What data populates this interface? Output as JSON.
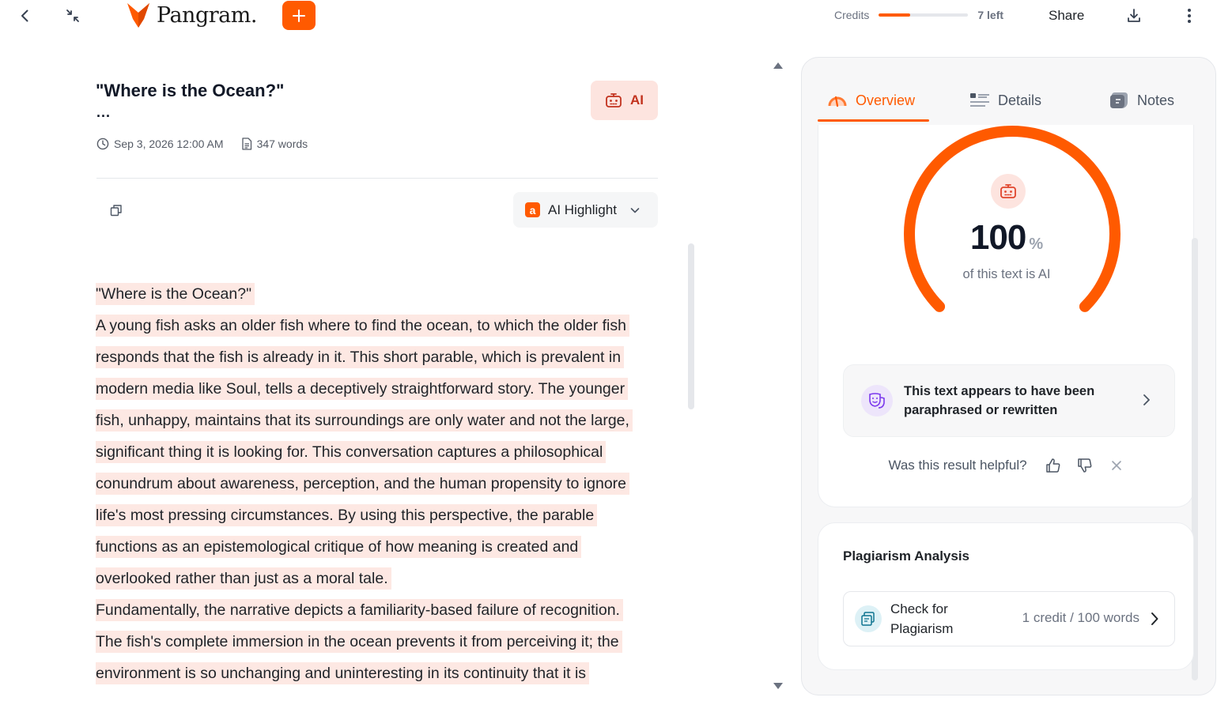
{
  "app": {
    "brand": "Pangram.",
    "accent_color": "#ff5a00",
    "credits_label": "Credits",
    "credits_remaining": "7 left",
    "credits_used_fraction": 0.35,
    "share_label": "Share"
  },
  "document": {
    "title": "\"Where is the Ocean?\"",
    "title_overflow": "...",
    "date": "Sep 3, 2026 12:00 AM",
    "word_count": "347 words",
    "verdict_badge": "AI",
    "highlight_mode": "AI Highlight",
    "highlight_mode_icon_letter": "a",
    "highlight_color": "#fde8e3",
    "lines": [
      "\"Where is the Ocean?\"",
      "A young fish asks an older fish where to find the ocean, to which the older fish",
      "responds that the fish is already in it. This short parable, which is prevalent in",
      "modern media like Soul, tells a deceptively straightforward story. The younger",
      "fish, unhappy, maintains that its surroundings are only water and not the large,",
      "significant thing it is looking for. This conversation captures a philosophical",
      "conundrum about awareness, perception, and the human propensity to ignore",
      "life's most pressing circumstances. By using this perspective, the parable",
      "functions as an epistemological critique of how meaning is created and",
      "overlooked rather than just as a moral tale.",
      "Fundamentally, the narrative depicts a familiarity-based failure of recognition.",
      "The fish's complete immersion in the ocean prevents it from perceiving it; the",
      "environment is so unchanging and uninteresting in its continuity that it is"
    ]
  },
  "panel": {
    "tabs": [
      {
        "label": "Overview",
        "icon": "overview-gauge-icon",
        "active": true
      },
      {
        "label": "Details",
        "icon": "details-list-icon",
        "active": false
      },
      {
        "label": "Notes",
        "icon": "notes-icon",
        "active": false
      }
    ],
    "overview": {
      "ai_percent": 100,
      "ai_percent_text": "100",
      "percent_sign": "%",
      "caption": "of this text is AI",
      "gauge_color": "#ff5a00",
      "paraphrase_notice": "This text appears to have been paraphrased or rewritten",
      "feedback_question": "Was this result helpful?"
    },
    "plagiarism": {
      "title": "Plagiarism Analysis",
      "action_label": "Check for Plagiarism",
      "cost": "1 credit / 100 words"
    }
  }
}
